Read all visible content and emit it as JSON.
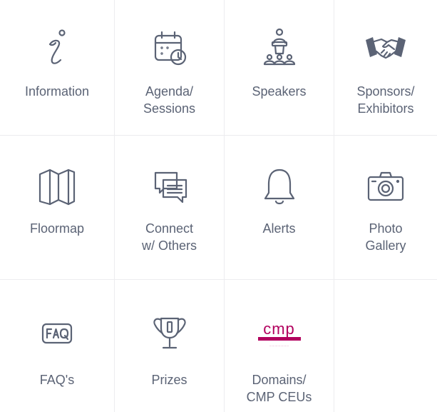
{
  "colors": {
    "icon_stroke": "#5b6375",
    "label_text": "#5b6375",
    "divider": "#ececef",
    "cmp_brand": "#b2005e"
  },
  "tiles": [
    {
      "icon": "info-icon",
      "label_lines": [
        "Information"
      ]
    },
    {
      "icon": "calendar-clock-icon",
      "label_lines": [
        "Agenda/",
        "Sessions"
      ]
    },
    {
      "icon": "speaker-podium-icon",
      "label_lines": [
        "Speakers"
      ]
    },
    {
      "icon": "handshake-icon",
      "label_lines": [
        "Sponsors/",
        "Exhibitors"
      ]
    },
    {
      "icon": "folded-map-icon",
      "label_lines": [
        "Floormap"
      ]
    },
    {
      "icon": "chat-bubbles-icon",
      "label_lines": [
        "Connect",
        "w/ Others"
      ]
    },
    {
      "icon": "bell-icon",
      "label_lines": [
        "Alerts"
      ]
    },
    {
      "icon": "camera-icon",
      "label_lines": [
        "Photo",
        "Gallery"
      ]
    },
    {
      "icon": "faq-icon",
      "label_lines": [
        "FAQ's"
      ]
    },
    {
      "icon": "trophy-icon",
      "label_lines": [
        "Prizes"
      ]
    },
    {
      "icon": "cmp-logo-icon",
      "label_lines": [
        "Domains/",
        "CMP CEUs"
      ],
      "logo_text": "cmp"
    }
  ]
}
